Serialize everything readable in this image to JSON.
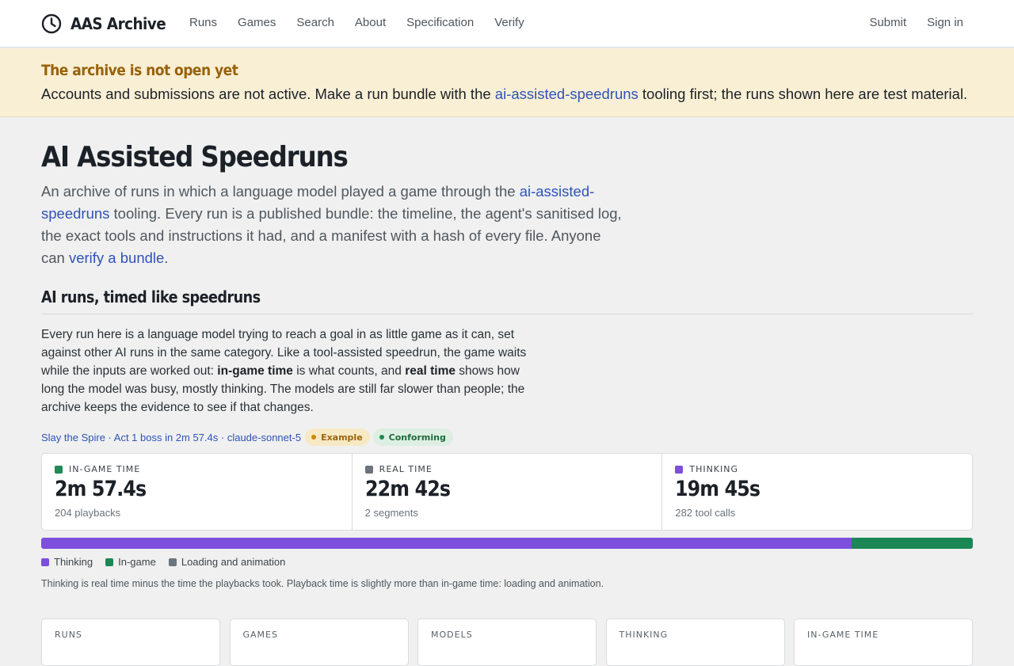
{
  "nav": {
    "brand": "AAS Archive",
    "links": [
      "Runs",
      "Games",
      "Search",
      "About",
      "Specification",
      "Verify"
    ],
    "right": [
      "Submit",
      "Sign in"
    ]
  },
  "notice": {
    "title": "The archive is not open yet",
    "text_before": "Accounts and submissions are not active. Make a run bundle with the ",
    "link": "ai-assisted-speedruns",
    "text_after": " tooling first; the runs shown here are test material."
  },
  "hero": {
    "title": "AI Assisted Speedruns",
    "lede_before": "An archive of runs in which a language model played a game through the ",
    "lede_link": "ai-assisted-speedruns",
    "lede_middle": " tooling. Every run is a published bundle: the timeline, the agent's sanitised log, the exact tools and instructions it had, and a manifest with a hash of every file. Anyone can ",
    "lede_link2": "verify a bundle",
    "lede_end": "."
  },
  "section": {
    "title": "AI runs, timed like speedruns",
    "p_before": "Every run here is a language model trying to reach a goal in as little game as it can, set against other AI runs in the same category. Like a tool-assisted speedrun, the game waits while the inputs are worked out: ",
    "p_bold1": "in-game time",
    "p_middle": " is what counts, and ",
    "p_bold2": "real time",
    "p_after": " shows how long the model was busy, mostly thinking. The models are still far slower than people; the archive keeps the evidence to see if that changes."
  },
  "example": {
    "link": "Slay the Spire · Act 1 boss in 2m 57.4s · claude-sonnet-5",
    "badge_example": "Example",
    "badge_conforming": "Conforming"
  },
  "stats": [
    {
      "label": "IN-GAME TIME",
      "value": "2m 57.4s",
      "sub": "204 playbacks",
      "color": "#1f8a54"
    },
    {
      "label": "REAL TIME",
      "value": "22m 42s",
      "sub": "2 segments",
      "color": "#6c747d"
    },
    {
      "label": "THINKING",
      "value": "19m 45s",
      "sub": "282 tool calls",
      "color": "#7d4fdc"
    }
  ],
  "timebar": {
    "segments": [
      {
        "name": "Thinking",
        "fraction": 0.87,
        "color": "#7d4fdc"
      },
      {
        "name": "In-game",
        "fraction": 0.13,
        "color": "#1a8754"
      },
      {
        "name": "Loading and animation",
        "fraction": 0.0,
        "color": "#6c747d"
      }
    ]
  },
  "legend": [
    "Thinking",
    "In-game",
    "Loading and animation"
  ],
  "note": "Thinking is real time minus the time the playbacks took. Playback time is slightly more than in-game time: loading and animation.",
  "cards": [
    "RUNS",
    "GAMES",
    "MODELS",
    "THINKING",
    "IN-GAME TIME"
  ]
}
